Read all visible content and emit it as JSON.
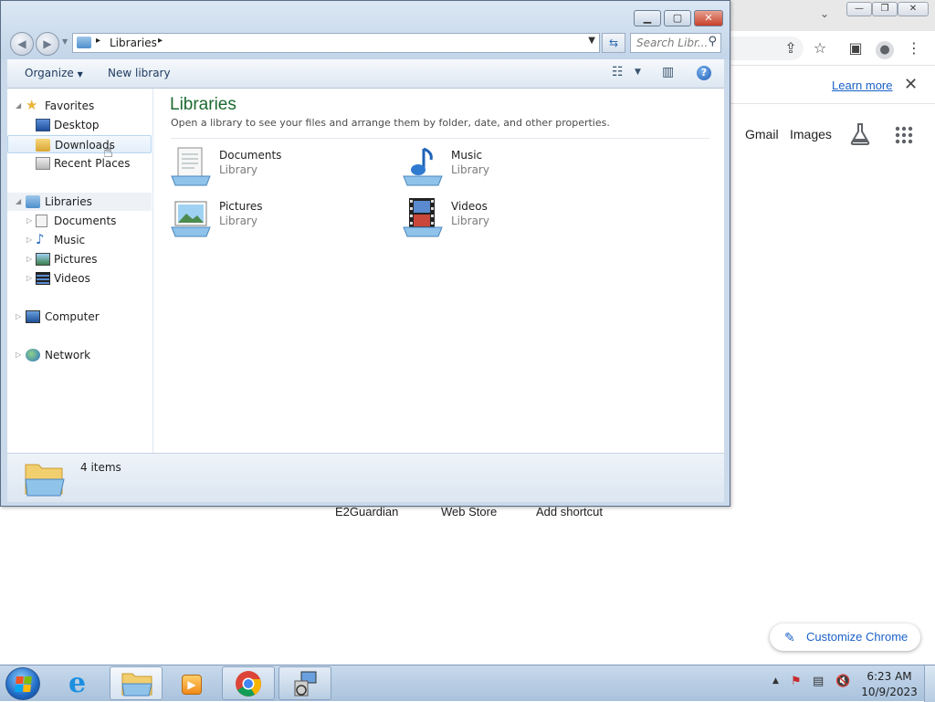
{
  "chrome": {
    "infobar": {
      "learn_more": "Learn more"
    },
    "links": {
      "gmail": "Gmail",
      "images": "Images"
    },
    "shortcuts": [
      "E2Guardian",
      "Web Store",
      "Add shortcut"
    ],
    "customize": "Customize Chrome"
  },
  "explorer": {
    "address": {
      "crumb": "Libraries"
    },
    "search": {
      "placeholder": "Search Libr..."
    },
    "toolbar": {
      "organize": "Organize",
      "new_library": "New library"
    },
    "nav": {
      "favorites": "Favorites",
      "desktop": "Desktop",
      "downloads": "Downloads",
      "recent": "Recent Places",
      "libraries": "Libraries",
      "documents": "Documents",
      "music": "Music",
      "pictures": "Pictures",
      "videos": "Videos",
      "computer": "Computer",
      "network": "Network"
    },
    "content": {
      "title": "Libraries",
      "subtitle": "Open a library to see your files and arrange them by folder, date, and other properties.",
      "libraries": [
        {
          "name": "Documents",
          "type": "Library"
        },
        {
          "name": "Music",
          "type": "Library"
        },
        {
          "name": "Pictures",
          "type": "Library"
        },
        {
          "name": "Videos",
          "type": "Library"
        }
      ]
    },
    "details": {
      "count": "4 items"
    }
  },
  "taskbar": {
    "clock": {
      "time": "6:23 AM",
      "date": "10/9/2023"
    }
  },
  "colors": {
    "accent_green": "#1d6a30",
    "link_blue": "#1a61c7",
    "taskbar": "#b6cde4"
  }
}
